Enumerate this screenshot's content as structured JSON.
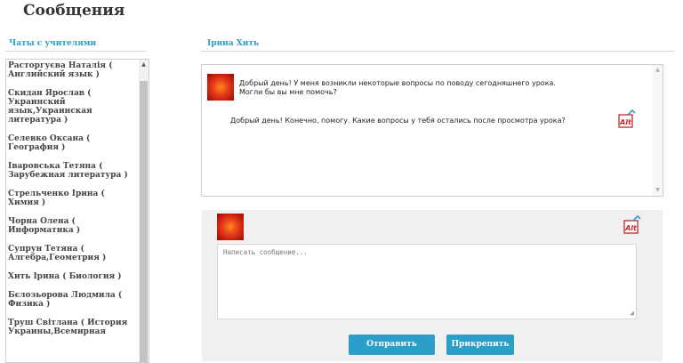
{
  "page": {
    "title": "Сообщения"
  },
  "sidebar": {
    "heading": "Чаты с учителями",
    "contacts": [
      "Расторгуєва Наталія ( Английский язык )",
      "Скидан Ярослав ( Украинский язык,Украинская литература )",
      "Селевко Оксана ( География )",
      "Іваровська Тетяна ( Зарубежная литература )",
      "Стрельченко Ірина ( Химия )",
      "Чорна Олена ( Информатика )",
      "Супрун Тетяна ( Алгебра,Геометрия )",
      "Хить Ірина ( Биология )",
      "Бєлозьорова Людмила ( Физика )",
      "Труш Світлана ( История Украины,Всемирная"
    ]
  },
  "chat": {
    "heading": "Ірина Хить",
    "messages": [
      {
        "line1": "Добрый день! У меня возникли некоторые вопросы по поводу сегодняшнего урока.",
        "line2": "Могли бы вы мне помочь?"
      },
      {
        "line1": "Добрый день! Конечно, помогу. Какие вопросы у тебя остались после просмотра урока?"
      }
    ]
  },
  "composer": {
    "placeholder": "Написать сообщение...",
    "send_label": "Отправить",
    "attach_label": "Прикрепить"
  },
  "colors": {
    "accent": "#2b9fc9",
    "heading_blue": "#2a9ec9"
  }
}
